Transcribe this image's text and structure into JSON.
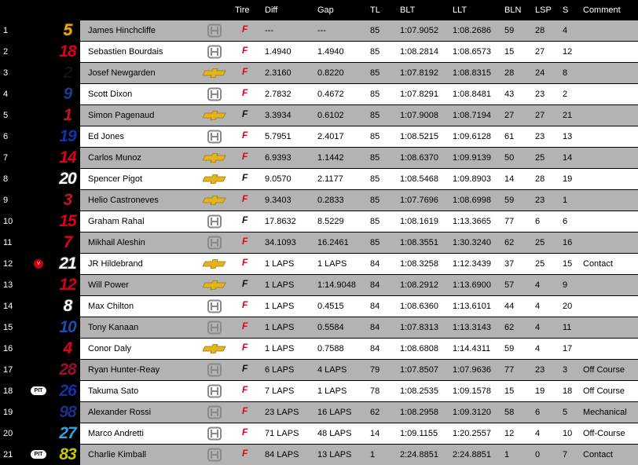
{
  "columns": {
    "tire": "Tire",
    "diff": "Diff",
    "gap": "Gap",
    "tl": "TL",
    "blt": "BLT",
    "llt": "LLT",
    "bln": "BLN",
    "lsp": "LSP",
    "s": "S",
    "comment": "Comment"
  },
  "colors": {
    "tire_red": "#e0001a",
    "tire_black": "#111111",
    "row_gray": "#b3b3b3",
    "row_white": "#ffffff"
  },
  "rows": [
    {
      "pos": "1",
      "num": "5",
      "num_color": "#f2a900",
      "num_outline": true,
      "driver": "James Hinchcliffe",
      "mfr": "honda",
      "mfr_icon": "honda-logo-icon",
      "tire": "red",
      "diff": "---",
      "gap": "---",
      "tl": "85",
      "blt": "1:07.9052",
      "llt": "1:08.2686",
      "bln": "59",
      "lsp": "28",
      "s": "4",
      "comment": "",
      "badge": ""
    },
    {
      "pos": "2",
      "num": "18",
      "num_color": "#e0001a",
      "num_outline": false,
      "driver": "Sebastien Bourdais",
      "mfr": "honda",
      "mfr_icon": "honda-logo-icon",
      "tire": "red",
      "diff": "1.4940",
      "gap": "1.4940",
      "tl": "85",
      "blt": "1:08.2814",
      "llt": "1:08.6573",
      "bln": "15",
      "lsp": "27",
      "s": "12",
      "comment": "",
      "badge": ""
    },
    {
      "pos": "3",
      "num": "2",
      "num_color": "#111111",
      "num_outline": false,
      "driver": "Josef Newgarden",
      "mfr": "chevrolet",
      "mfr_icon": "chevrolet-bowtie-icon",
      "tire": "red",
      "diff": "2.3160",
      "gap": "0.8220",
      "tl": "85",
      "blt": "1:07.8192",
      "llt": "1:08.8315",
      "bln": "28",
      "lsp": "24",
      "s": "8",
      "comment": "",
      "badge": ""
    },
    {
      "pos": "4",
      "num": "9",
      "num_color": "#1a3a8f",
      "num_outline": false,
      "driver": "Scott Dixon",
      "mfr": "honda",
      "mfr_icon": "honda-logo-icon",
      "tire": "red",
      "diff": "2.7832",
      "gap": "0.4672",
      "tl": "85",
      "blt": "1:07.8291",
      "llt": "1:08.8481",
      "bln": "43",
      "lsp": "23",
      "s": "2",
      "comment": "",
      "badge": ""
    },
    {
      "pos": "5",
      "num": "1",
      "num_color": "#c8102e",
      "num_outline": false,
      "driver": "Simon Pagenaud",
      "mfr": "chevrolet",
      "mfr_icon": "chevrolet-bowtie-icon",
      "tire": "black",
      "diff": "3.3934",
      "gap": "0.6102",
      "tl": "85",
      "blt": "1:07.9008",
      "llt": "1:08.7194",
      "bln": "27",
      "lsp": "27",
      "s": "21",
      "comment": "",
      "badge": ""
    },
    {
      "pos": "6",
      "num": "19",
      "num_color": "#1530a8",
      "num_outline": false,
      "driver": "Ed Jones",
      "mfr": "honda",
      "mfr_icon": "honda-logo-icon",
      "tire": "red",
      "diff": "5.7951",
      "gap": "2.4017",
      "tl": "85",
      "blt": "1:08.5215",
      "llt": "1:09.6128",
      "bln": "61",
      "lsp": "23",
      "s": "13",
      "comment": "",
      "badge": ""
    },
    {
      "pos": "7",
      "num": "14",
      "num_color": "#e0001a",
      "num_outline": false,
      "driver": "Carlos Munoz",
      "mfr": "chevrolet",
      "mfr_icon": "chevrolet-bowtie-icon",
      "tire": "red",
      "diff": "6.9393",
      "gap": "1.1442",
      "tl": "85",
      "blt": "1:08.6370",
      "llt": "1:09.9139",
      "bln": "50",
      "lsp": "25",
      "s": "14",
      "comment": "",
      "badge": ""
    },
    {
      "pos": "8",
      "num": "20",
      "num_color": "#ffffff",
      "num_outline": true,
      "driver": "Spencer Pigot",
      "mfr": "chevrolet",
      "mfr_icon": "chevrolet-bowtie-icon",
      "tire": "black",
      "diff": "9.0570",
      "gap": "2.1177",
      "tl": "85",
      "blt": "1:08.5468",
      "llt": "1:09.8903",
      "bln": "14",
      "lsp": "28",
      "s": "19",
      "comment": "",
      "badge": ""
    },
    {
      "pos": "9",
      "num": "3",
      "num_color": "#c8102e",
      "num_outline": false,
      "driver": "Helio Castroneves",
      "mfr": "chevrolet",
      "mfr_icon": "chevrolet-bowtie-icon",
      "tire": "red",
      "diff": "9.3403",
      "gap": "0.2833",
      "tl": "85",
      "blt": "1:07.7696",
      "llt": "1:08.6998",
      "bln": "59",
      "lsp": "23",
      "s": "1",
      "comment": "",
      "badge": ""
    },
    {
      "pos": "10",
      "num": "15",
      "num_color": "#e0001a",
      "num_outline": false,
      "driver": "Graham Rahal",
      "mfr": "honda",
      "mfr_icon": "honda-logo-icon",
      "tire": "black",
      "diff": "17.8632",
      "gap": "8.5229",
      "tl": "85",
      "blt": "1:08.1619",
      "llt": "1:13.3665",
      "bln": "77",
      "lsp": "6",
      "s": "6",
      "comment": "",
      "badge": ""
    },
    {
      "pos": "11",
      "num": "7",
      "num_color": "#e0001a",
      "num_outline": false,
      "driver": "Mikhail Aleshin",
      "mfr": "honda",
      "mfr_icon": "honda-logo-icon",
      "tire": "red",
      "diff": "34.1093",
      "gap": "16.2461",
      "tl": "85",
      "blt": "1:08.3551",
      "llt": "1:30.3240",
      "bln": "62",
      "lsp": "25",
      "s": "16",
      "comment": "",
      "badge": ""
    },
    {
      "pos": "12",
      "num": "21",
      "num_color": "#ffffff",
      "num_outline": true,
      "driver": "JR Hildebrand",
      "mfr": "chevrolet",
      "mfr_icon": "chevrolet-bowtie-icon",
      "tire": "red",
      "diff": "1 LAPS",
      "gap": "1 LAPS",
      "tl": "84",
      "blt": "1:08.3258",
      "llt": "1:12.3439",
      "bln": "37",
      "lsp": "25",
      "s": "15",
      "comment": "Contact",
      "badge": "down"
    },
    {
      "pos": "13",
      "num": "12",
      "num_color": "#d4001a",
      "num_outline": false,
      "driver": "Will Power",
      "mfr": "chevrolet",
      "mfr_icon": "chevrolet-bowtie-icon",
      "tire": "black",
      "diff": "1 LAPS",
      "gap": "1:14.9048",
      "tl": "84",
      "blt": "1:08.2912",
      "llt": "1:13.6900",
      "bln": "57",
      "lsp": "4",
      "s": "9",
      "comment": "",
      "badge": ""
    },
    {
      "pos": "14",
      "num": "8",
      "num_color": "#ffffff",
      "num_outline": true,
      "driver": "Max Chilton",
      "mfr": "honda",
      "mfr_icon": "honda-logo-icon",
      "tire": "red",
      "diff": "1 LAPS",
      "gap": "0.4515",
      "tl": "84",
      "blt": "1:08.6360",
      "llt": "1:13.6101",
      "bln": "44",
      "lsp": "4",
      "s": "20",
      "comment": "",
      "badge": ""
    },
    {
      "pos": "15",
      "num": "10",
      "num_color": "#1a4fb0",
      "num_outline": false,
      "driver": "Tony Kanaan",
      "mfr": "honda",
      "mfr_icon": "honda-logo-icon",
      "tire": "red",
      "diff": "1 LAPS",
      "gap": "0.5584",
      "tl": "84",
      "blt": "1:07.8313",
      "llt": "1:13.3143",
      "bln": "62",
      "lsp": "4",
      "s": "11",
      "comment": "",
      "badge": ""
    },
    {
      "pos": "16",
      "num": "4",
      "num_color": "#e0001a",
      "num_outline": false,
      "driver": "Conor Daly",
      "mfr": "chevrolet",
      "mfr_icon": "chevrolet-bowtie-icon",
      "tire": "red",
      "diff": "1 LAPS",
      "gap": "0.7588",
      "tl": "84",
      "blt": "1:08.6808",
      "llt": "1:14.4311",
      "bln": "59",
      "lsp": "4",
      "s": "17",
      "comment": "",
      "badge": ""
    },
    {
      "pos": "17",
      "num": "28",
      "num_color": "#9b1030",
      "num_outline": false,
      "driver": "Ryan Hunter-Reay",
      "mfr": "honda",
      "mfr_icon": "honda-logo-icon",
      "tire": "black",
      "diff": "6 LAPS",
      "gap": "4 LAPS",
      "tl": "79",
      "blt": "1:07.8507",
      "llt": "1:07.9636",
      "bln": "77",
      "lsp": "23",
      "s": "3",
      "comment": "Off Course",
      "badge": ""
    },
    {
      "pos": "18",
      "num": "26",
      "num_color": "#1530a8",
      "num_outline": false,
      "driver": "Takuma Sato",
      "mfr": "honda",
      "mfr_icon": "honda-logo-icon",
      "tire": "red",
      "diff": "7 LAPS",
      "gap": "1 LAPS",
      "tl": "78",
      "blt": "1:08.2535",
      "llt": "1:09.1578",
      "bln": "15",
      "lsp": "19",
      "s": "18",
      "comment": "Off Course",
      "badge": "pit"
    },
    {
      "pos": "19",
      "num": "98",
      "num_color": "#1c2f8a",
      "num_outline": false,
      "driver": "Alexander Rossi",
      "mfr": "honda",
      "mfr_icon": "honda-logo-icon",
      "tire": "red",
      "diff": "23 LAPS",
      "gap": "16 LAPS",
      "tl": "62",
      "blt": "1:08.2958",
      "llt": "1:09.3120",
      "bln": "58",
      "lsp": "6",
      "s": "5",
      "comment": "Mechanical",
      "badge": ""
    },
    {
      "pos": "20",
      "num": "27",
      "num_color": "#2aa9e0",
      "num_outline": false,
      "driver": "Marco Andretti",
      "mfr": "honda",
      "mfr_icon": "honda-logo-icon",
      "tire": "red",
      "diff": "71 LAPS",
      "gap": "48 LAPS",
      "tl": "14",
      "blt": "1:09.1155",
      "llt": "1:20.2557",
      "bln": "12",
      "lsp": "4",
      "s": "10",
      "comment": "Off-Course",
      "badge": ""
    },
    {
      "pos": "21",
      "num": "83",
      "num_color": "#c8c800",
      "num_outline": false,
      "driver": "Charlie Kimball",
      "mfr": "honda",
      "mfr_icon": "honda-logo-icon",
      "tire": "red",
      "diff": "84 LAPS",
      "gap": "13 LAPS",
      "tl": "1",
      "blt": "2:24.8851",
      "llt": "2:24.8851",
      "bln": "1",
      "lsp": "0",
      "s": "7",
      "comment": "Contact",
      "badge": "pit"
    }
  ],
  "badges": {
    "pit": "PIT",
    "down": "˅"
  },
  "tire_glyph": "F"
}
